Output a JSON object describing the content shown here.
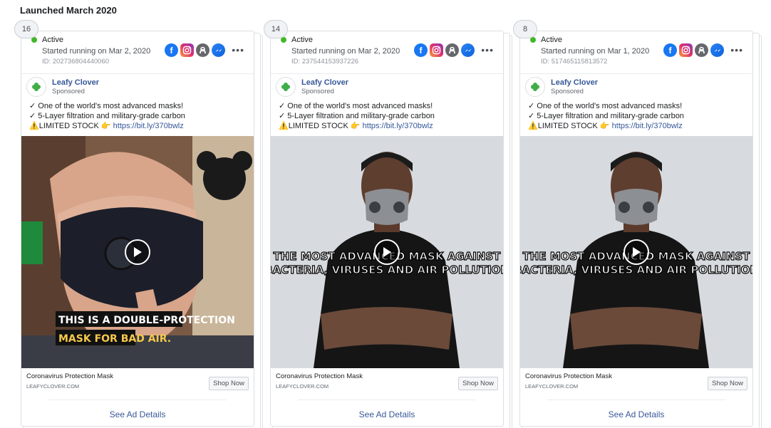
{
  "section_title": "Launched March 2020",
  "colors": {
    "active": "#42b72a",
    "link": "#365899",
    "facebook": "#1877f2"
  },
  "cards": [
    {
      "count": "16",
      "status": "Active",
      "started": "Started running on Mar 2, 2020",
      "id": "ID: 202736804440060",
      "platforms": [
        "facebook-icon",
        "instagram-icon",
        "audience-network-icon",
        "messenger-icon"
      ],
      "advertiser": "Leafy Clover",
      "sponsored": "Sponsored",
      "line1": "✓ One of the world's most advanced masks!",
      "line2": "✓ 5-Layer filtration and military-grade carbon",
      "line3_prefix": "⚠️LIMITED STOCK 👉",
      "link": "https://bit.ly/370bwlz",
      "media_type": "video",
      "media_caption_1": "THIS IS A DOUBLE-PROTECTION",
      "media_caption_2": "MASK FOR BAD AIR.",
      "cta_title": "Coronavirus Protection Mask",
      "cta_domain": "LEAFYCLOVER.COM",
      "cta_button": "Shop Now",
      "details": "See Ad Details"
    },
    {
      "count": "14",
      "status": "Active",
      "started": "Started running on Mar 2, 2020",
      "id": "ID: 237544153937226",
      "platforms": [
        "facebook-icon",
        "instagram-icon",
        "audience-network-icon",
        "messenger-icon"
      ],
      "advertiser": "Leafy Clover",
      "sponsored": "Sponsored",
      "line1": "✓ One of the world's most advanced masks!",
      "line2": "✓ 5-Layer filtration and military-grade carbon",
      "line3_prefix": "⚠️LIMITED STOCK 👉",
      "link": "https://bit.ly/370bwlz",
      "media_type": "video",
      "media_caption_1": "THE MOST ADVANCED MASK AGAINST",
      "media_caption_2": "BACTERIA, VIRUSES AND AIR POLLUTION",
      "cta_title": "Coronavirus Protection Mask",
      "cta_domain": "LEAFYCLOVER.COM",
      "cta_button": "Shop Now",
      "details": "See Ad Details"
    },
    {
      "count": "8",
      "status": "Active",
      "started": "Started running on Mar 1, 2020",
      "id": "ID: 517465115813572",
      "platforms": [
        "facebook-icon",
        "instagram-icon",
        "audience-network-icon",
        "messenger-icon"
      ],
      "advertiser": "Leafy Clover",
      "sponsored": "Sponsored",
      "line1": "✓ One of the world's most advanced masks!",
      "line2": "✓ 5-Layer filtration and military-grade carbon",
      "line3_prefix": "⚠️LIMITED STOCK 👉",
      "link": "https://bit.ly/370bwlz",
      "media_type": "video",
      "media_caption_1": "THE MOST ADVANCED MASK AGAINST",
      "media_caption_2": "BACTERIA, VIRUSES AND AIR POLLUTION",
      "cta_title": "Coronavirus Protection Mask",
      "cta_domain": "LEAFYCLOVER.COM",
      "cta_button": "Shop Now",
      "details": "See Ad Details"
    }
  ]
}
